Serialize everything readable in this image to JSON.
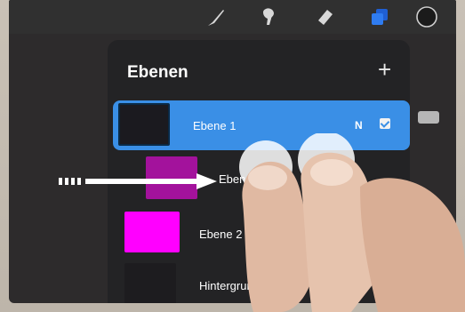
{
  "panel": {
    "title": "Ebenen",
    "add_label": "+"
  },
  "layers": [
    {
      "name": "Ebene 1",
      "blend_mode": "N",
      "visible": true,
      "selected": true,
      "thumb_color": "#1b1a1f"
    },
    {
      "name": "Ebene",
      "dragging": true,
      "thumb_color": "#a3129c"
    },
    {
      "name": "Ebene 2",
      "thumb_color": "#ff00ff"
    },
    {
      "name": "Hintergrundf",
      "thumb_color": "#1d1c1f"
    }
  ],
  "toolbar": {
    "tools": [
      "brush-icon",
      "smudge-icon",
      "eraser-icon",
      "layers-icon",
      "color-icon"
    ],
    "accent": "#2f7cf0"
  },
  "colors": {
    "selection": "#3a8fe6",
    "panel": "#232325"
  }
}
